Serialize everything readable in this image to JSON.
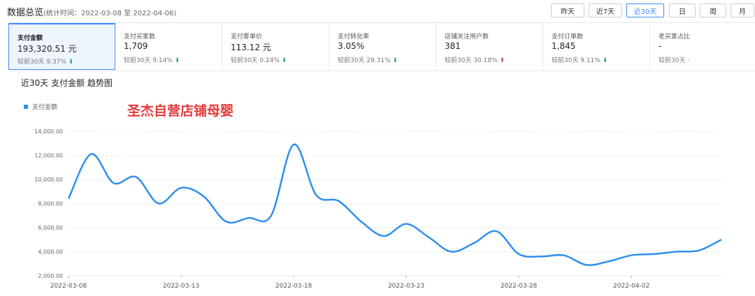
{
  "header": {
    "title": "数据总览",
    "range_text": "(统计时间：2022-03-08 至 2022-04-06)",
    "buttons": [
      {
        "label": "昨天",
        "active": false
      },
      {
        "label": "近7天",
        "active": false
      },
      {
        "label": "近30天",
        "active": true
      },
      {
        "label": "日",
        "active": false
      },
      {
        "label": "周",
        "active": false
      },
      {
        "label": "月",
        "active": false
      }
    ]
  },
  "cards": [
    {
      "label": "支付金额",
      "value": "193,320.51 元",
      "compare": "较前30天 9.37%",
      "trend": "down",
      "active": true
    },
    {
      "label": "支付买家数",
      "value": "1,709",
      "compare": "较前30天 9.14%",
      "trend": "down",
      "active": false
    },
    {
      "label": "支付客单价",
      "value": "113.12 元",
      "compare": "较前30天 0.24%",
      "trend": "down",
      "active": false
    },
    {
      "label": "支付转化率",
      "value": "3.05%",
      "compare": "较前30天 29.31%",
      "trend": "down",
      "active": false
    },
    {
      "label": "店铺关注用户数",
      "value": "381",
      "compare": "较前30天 30.18%",
      "trend": "up",
      "active": false
    },
    {
      "label": "支付订单数",
      "value": "1,845",
      "compare": "较前30天 9.11%",
      "trend": "down",
      "active": false
    },
    {
      "label": "老买家占比",
      "value": "-",
      "compare": "较前30天 -",
      "trend": "none",
      "active": false
    }
  ],
  "chart_section": {
    "title": "近30天 支付金额 趋势图",
    "watermark": "圣杰自营店铺母婴"
  },
  "chart_data": {
    "type": "line",
    "title": "近30天 支付金额 趋势图",
    "xlabel": "",
    "ylabel": "",
    "ylim": [
      2000,
      14000
    ],
    "yticks": [
      "2,000.00",
      "4,000.00",
      "6,000.00",
      "8,000.00",
      "10,000.00",
      "12,000.00",
      "14,000.00"
    ],
    "xticks": [
      "2022-03-08",
      "2022-03-13",
      "2022-03-18",
      "2022-03-23",
      "2022-03-28",
      "2022-04-02"
    ],
    "grid": true,
    "legend_position": "top-left",
    "color": "#2f8fef",
    "series": [
      {
        "name": "支付金额",
        "x": [
          "2022-03-08",
          "2022-03-09",
          "2022-03-10",
          "2022-03-11",
          "2022-03-12",
          "2022-03-13",
          "2022-03-14",
          "2022-03-15",
          "2022-03-16",
          "2022-03-17",
          "2022-03-18",
          "2022-03-19",
          "2022-03-20",
          "2022-03-21",
          "2022-03-22",
          "2022-03-23",
          "2022-03-24",
          "2022-03-25",
          "2022-03-26",
          "2022-03-27",
          "2022-03-28",
          "2022-03-29",
          "2022-03-30",
          "2022-03-31",
          "2022-04-01",
          "2022-04-02",
          "2022-04-03",
          "2022-04-04",
          "2022-04-05",
          "2022-04-06"
        ],
        "values": [
          8400,
          12100,
          9700,
          10200,
          8000,
          9300,
          8600,
          6500,
          6800,
          7000,
          12900,
          8700,
          8200,
          6500,
          5300,
          6300,
          5200,
          4000,
          4700,
          5700,
          3800,
          3600,
          3700,
          2900,
          3200,
          3700,
          3800,
          4000,
          4100,
          5000
        ]
      }
    ]
  }
}
